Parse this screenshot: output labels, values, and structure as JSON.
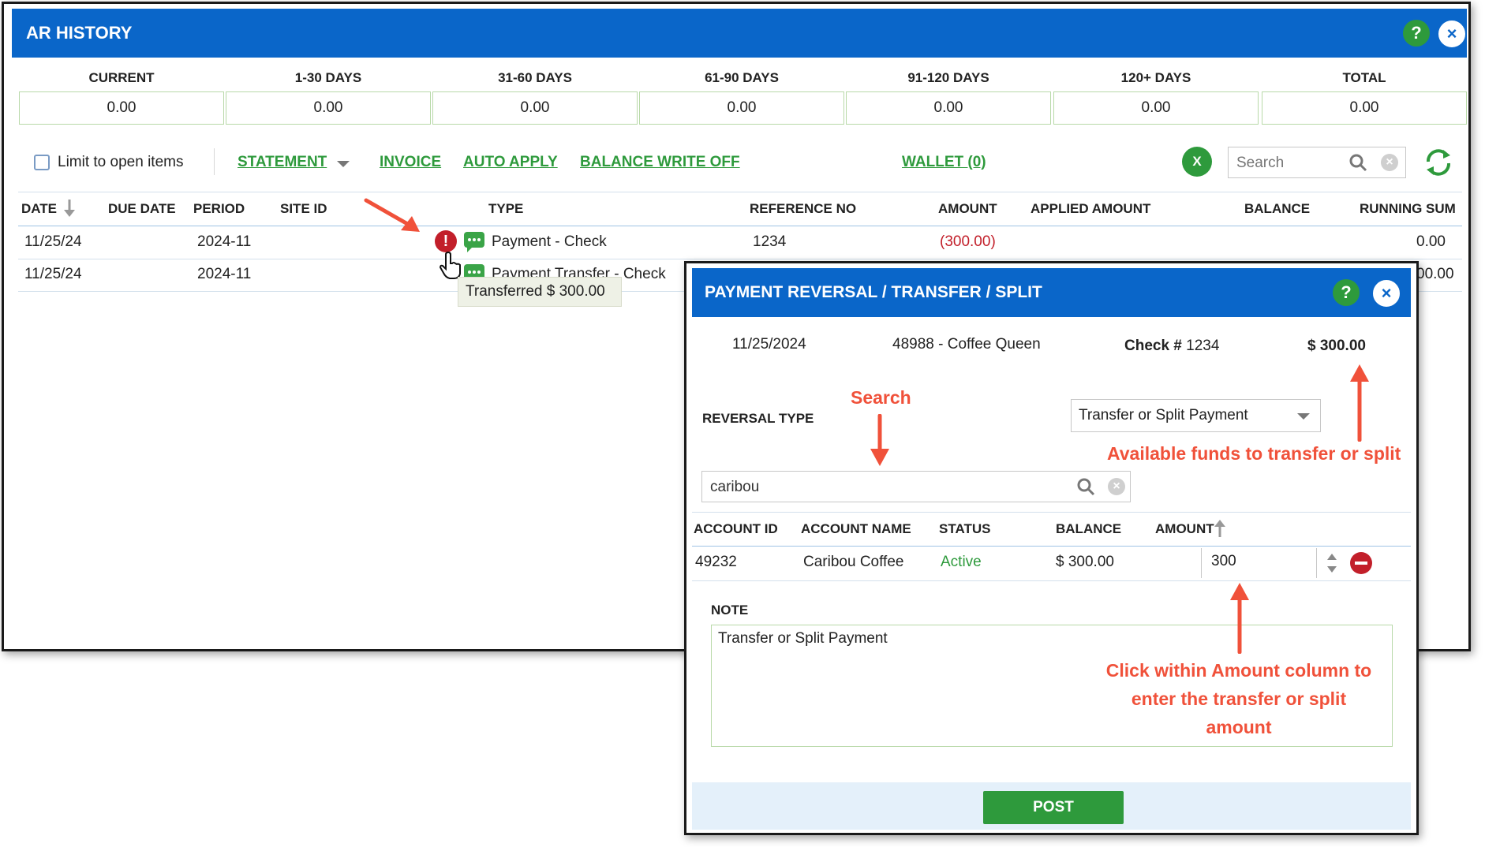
{
  "window": {
    "title": "AR HISTORY",
    "help_icon": "?",
    "close_icon": "×"
  },
  "aging": {
    "labels": [
      "CURRENT",
      "1-30 DAYS",
      "31-60 DAYS",
      "61-90 DAYS",
      "91-120 DAYS",
      "120+ DAYS",
      "TOTAL"
    ],
    "values": [
      "0.00",
      "0.00",
      "0.00",
      "0.00",
      "0.00",
      "0.00",
      "0.00"
    ]
  },
  "toolbar": {
    "limit_label": "Limit to open items",
    "statement": "STATEMENT",
    "invoice": "INVOICE",
    "auto_apply": "AUTO APPLY",
    "balance_write_off": "BALANCE WRITE OFF",
    "wallet": "WALLET (0)",
    "excel_icon": "X",
    "search_placeholder": "Search"
  },
  "table": {
    "headers": {
      "date": "DATE",
      "due_date": "DUE DATE",
      "period": "PERIOD",
      "site_id": "SITE ID",
      "type": "TYPE",
      "reference_no": "REFERENCE NO",
      "amount": "AMOUNT",
      "applied_amount": "APPLIED AMOUNT",
      "balance": "BALANCE",
      "running_sum": "RUNNING SUM"
    },
    "rows": [
      {
        "date": "11/25/24",
        "period": "2024-11",
        "type": "Payment - Check",
        "reference_no": "1234",
        "amount": "(300.00)",
        "running_sum": "0.00"
      },
      {
        "date": "11/25/24",
        "period": "2024-11",
        "type": "Payment Transfer - Check",
        "running_sum": "00.00"
      }
    ],
    "error_icon": "!",
    "tooltip": "Transferred $ 300.00"
  },
  "dialog": {
    "title": "PAYMENT REVERSAL / TRANSFER / SPLIT",
    "help_icon": "?",
    "close_icon": "×",
    "date": "11/25/2024",
    "customer": "48988 - Coffee Queen",
    "check_label": "Check #",
    "check_number": "1234",
    "amount": "$ 300.00",
    "reversal_type_label": "REVERSAL TYPE",
    "reversal_type_value": "Transfer or Split Payment",
    "search_value": "caribou",
    "columns": {
      "account_id": "ACCOUNT ID",
      "account_name": "ACCOUNT NAME",
      "status": "STATUS",
      "balance": "BALANCE",
      "amount": "AMOUNT"
    },
    "row": {
      "account_id": "49232",
      "account_name": "Caribou Coffee",
      "status": "Active",
      "balance": "$ 300.00",
      "amount": "300"
    },
    "note_label": "NOTE",
    "note_value": "Transfer or Split Payment",
    "post_label": "POST"
  },
  "annotations": {
    "search": "Search",
    "available_funds": "Available funds to transfer or split",
    "click_amount": "Click within Amount column to enter the transfer or split amount"
  },
  "colors": {
    "title_bar": "#0a66c9",
    "accent_green": "#2e9a3c",
    "negative_red": "#c21f2a",
    "annotation": "#f0513a"
  }
}
